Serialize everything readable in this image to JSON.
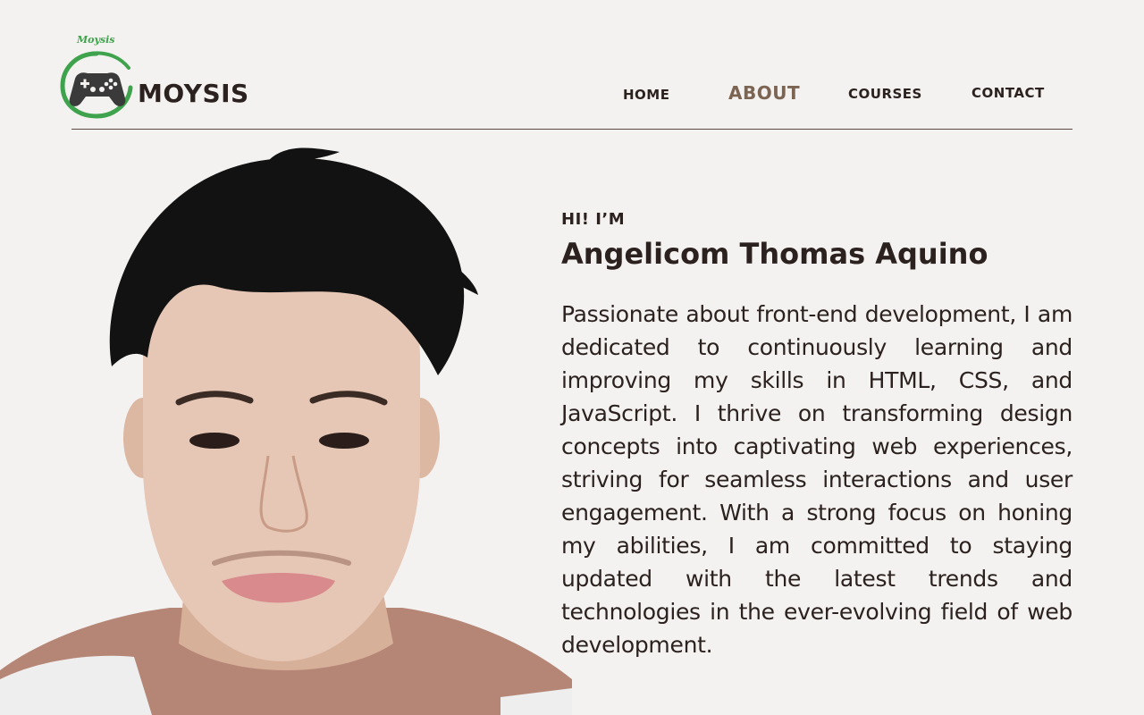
{
  "brand": {
    "tag": "Moysis",
    "name": "MOYSIS"
  },
  "nav": {
    "home": "HOME",
    "about": "ABOUT",
    "courses": "COURSES",
    "contact": "CONTACT",
    "active": "ABOUT"
  },
  "intro": {
    "greeting": "HI! I’M",
    "name": "Angelicom Thomas Aquino",
    "bio": "Passionate about front-end development, I am dedicated to continuously learning and improving my skills in HTML, CSS, and JavaScript. I thrive on transforming design concepts into captivating web experiences, striving for seamless interactions and user engagement. With a strong focus on honing my abilities, I am committed to staying updated with the latest trends and technologies in the ever-evolving field of web development."
  },
  "colors": {
    "background": "#f4f2f0",
    "text": "#2b211f",
    "accent_nav_active": "#7b6452",
    "logo_green": "#3fa34d"
  },
  "icons": {
    "logo_emblem": "gamepad-icon"
  }
}
